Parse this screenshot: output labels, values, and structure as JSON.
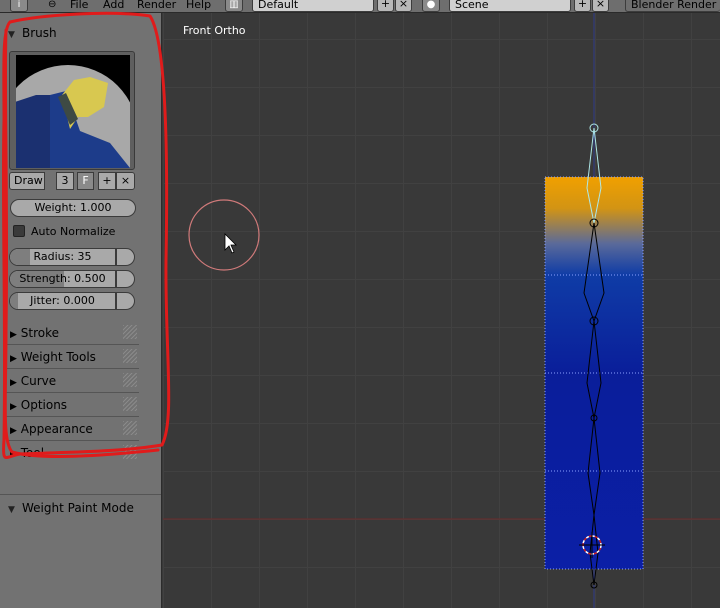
{
  "topbar": {
    "menus": [
      "File",
      "Add",
      "Render",
      "Help"
    ],
    "screen_layout": "Default",
    "scene": "Scene",
    "render_engine": "Blender Render"
  },
  "toolshelf": {
    "brush_panel_title": "Brush",
    "brush_name": "Draw",
    "brush_users": "3",
    "fake_user": "F",
    "weight": "Weight: 1.000",
    "auto_normalize": "Auto Normalize",
    "auto_normalize_checked": false,
    "radius": "Radius: 35",
    "strength": "Strength: 0.500",
    "strength_value": 0.5,
    "jitter": "Jitter: 0.000",
    "collapsed_panels": [
      "Stroke",
      "Weight Tools",
      "Curve",
      "Options",
      "Appearance",
      "Tool"
    ],
    "mode_panel_title": "Weight Paint Mode"
  },
  "viewport": {
    "view_label": "Front Ortho"
  },
  "colors": {
    "annotation": "#e01b1b",
    "weight_high": "#f0a000",
    "weight_low": "#0b1fa6",
    "background": "#393939"
  }
}
